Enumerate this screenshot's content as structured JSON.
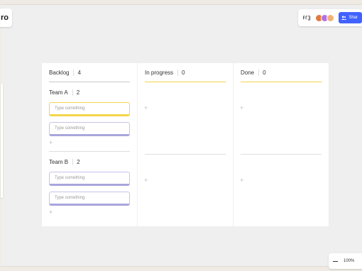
{
  "app": {
    "logo_text": "ro"
  },
  "toolbar": {
    "reactions_icon": "reactions-icon",
    "avatars": [
      {
        "color": "#e07a3f"
      },
      {
        "color": "#b46fe0"
      },
      {
        "color": "#f2b179"
      }
    ],
    "share_label": "Shar",
    "share_icon": "users-icon"
  },
  "board": {
    "columns": [
      {
        "title": "Backlog",
        "count": "4",
        "groups": [
          {
            "title": "Team A",
            "count": "2",
            "cards": [
              {
                "placeholder": "Type something"
              },
              {
                "placeholder": "Type something"
              }
            ],
            "add_label": "+"
          },
          {
            "title": "Team B",
            "count": "2",
            "cards": [
              {
                "placeholder": "Type something"
              },
              {
                "placeholder": "Type something"
              }
            ],
            "add_label": "+"
          }
        ]
      },
      {
        "title": "In progress",
        "count": "0",
        "add_label": "+"
      },
      {
        "title": "Done",
        "count": "0",
        "add_label": "+"
      }
    ]
  },
  "zoom": {
    "level": "100%"
  },
  "colors": {
    "accent_yellow": "#f3d54a",
    "card_border": "#a9a5dd",
    "share_blue": "#4262ff"
  }
}
